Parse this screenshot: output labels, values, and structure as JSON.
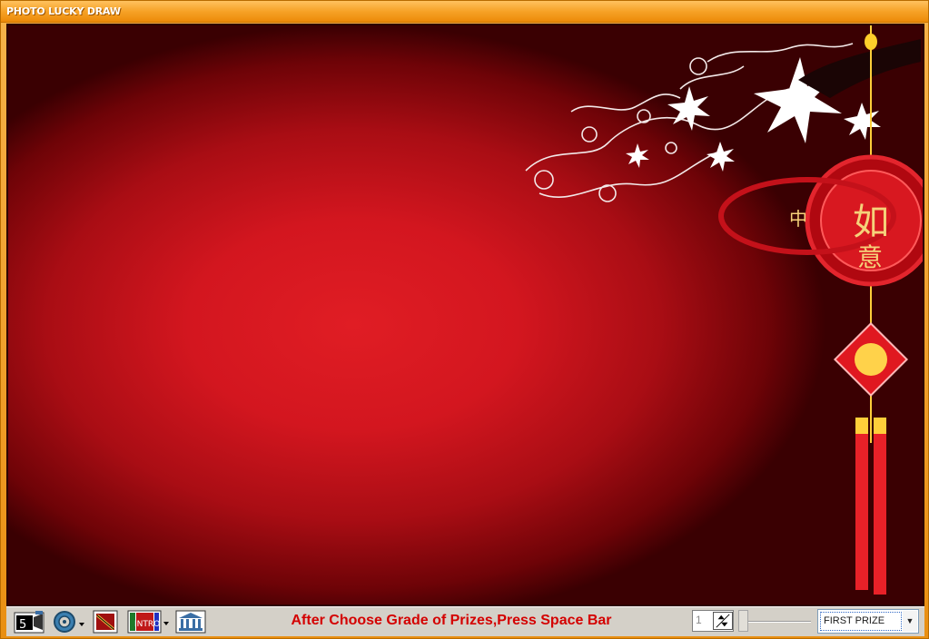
{
  "window": {
    "title": "PHOTO LUCKY DRAW"
  },
  "stage": {
    "background_color": "#d3161f",
    "edge_color": "#3a0002"
  },
  "toolbar": {
    "icons": [
      {
        "name": "slideshow-camera-icon",
        "label": "5"
      },
      {
        "name": "sound-disc-icon"
      },
      {
        "name": "edit-photo-icon"
      },
      {
        "name": "intro-icon",
        "label": "INTRO"
      },
      {
        "name": "bank-building-icon"
      }
    ]
  },
  "status": {
    "instruction": "After Choose Grade of Prizes,Press Space Bar"
  },
  "controls": {
    "count_value": "1",
    "prize_selected": "FIRST PRIZE"
  }
}
